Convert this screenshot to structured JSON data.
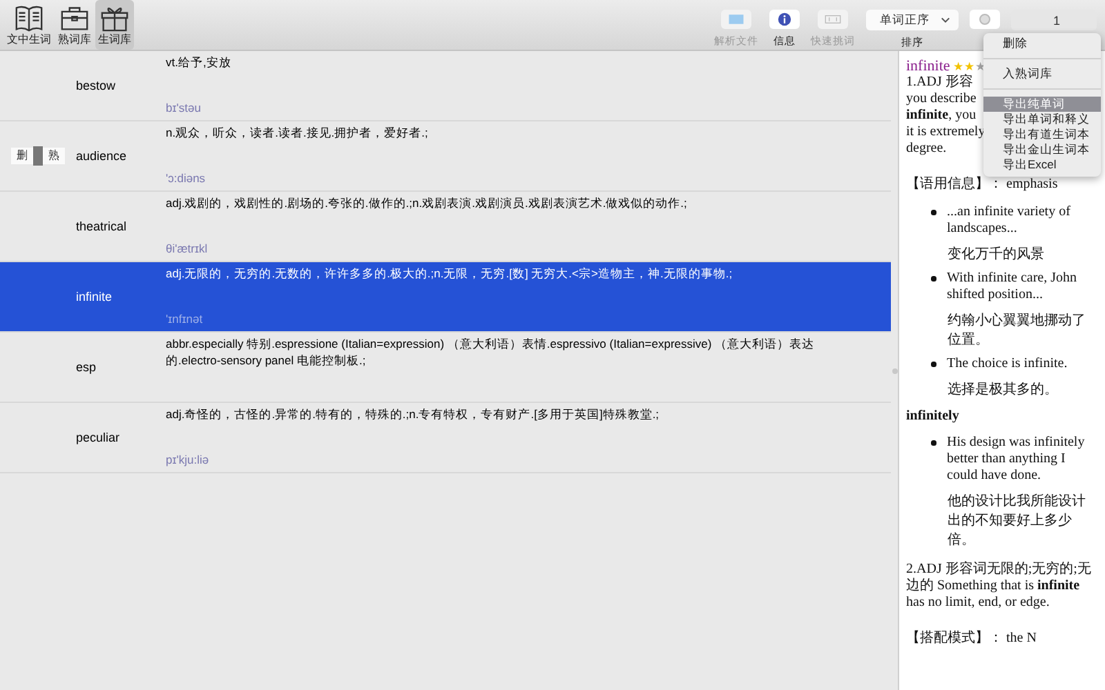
{
  "toolbar_left": [
    {
      "label": "文中生词",
      "selected": false
    },
    {
      "label": "熟词库",
      "selected": false
    },
    {
      "label": "生词库",
      "selected": true
    }
  ],
  "toolbar_right": [
    {
      "kind": "button",
      "label": "解析文件",
      "disabled": true
    },
    {
      "kind": "button",
      "label": "信息",
      "disabled": false
    },
    {
      "kind": "button",
      "label": "快速挑词",
      "disabled": true
    },
    {
      "kind": "dropdown",
      "label": "排序",
      "value": "单词正序"
    },
    {
      "kind": "button",
      "disabled": false
    }
  ],
  "page_dropdown": {
    "value": "1"
  },
  "words": [
    {
      "word": "bestow",
      "definition": "vt.给予,安放",
      "phonetic": "bɪ'stəu",
      "selected": false
    },
    {
      "word": "audience",
      "definition": "n.观众，听众，读者.读者.接见.拥护者，爱好者.;",
      "phonetic": "'ɔ:diəns",
      "selected": false,
      "actions": [
        "删",
        "熟"
      ]
    },
    {
      "word": "theatrical",
      "definition": "adj.戏剧的，戏剧性的.剧场的.夸张的.做作的.;n.戏剧表演.戏剧演员.戏剧表演艺术.做戏似的动作.;",
      "phonetic": "θi'ætrɪkl",
      "selected": false
    },
    {
      "word": "infinite",
      "definition": "adj.无限的，无穷的.无数的，许许多多的.极大的.;n.无限，无穷.[数] 无穷大.<宗>造物主，神.无限的事物.;",
      "phonetic": "'ɪnfɪnət",
      "selected": true
    },
    {
      "word": "esp",
      "definition": "abbr.especially 特别.espressione (Italian=expression) （意大利语）表情.espressivo (Italian=expressive) （意大利语）表达的.electro-sensory panel 电能控制板.;",
      "selected": false
    },
    {
      "word": "peculiar",
      "definition": "adj.奇怪的，古怪的.异常的.特有的，特殊的.;n.专有特权，专有财产.[多用于英国]特殊教堂.;",
      "phonetic": "pɪ'kju:liə",
      "selected": false
    }
  ],
  "menu": {
    "groups": [
      [
        {
          "label": "删除",
          "selected": false
        }
      ],
      [
        {
          "label": "入熟词库",
          "selected": false
        }
      ],
      [
        {
          "label": "导出纯单词",
          "selected": true
        },
        {
          "label": "导出单词和释义",
          "selected": false
        },
        {
          "label": "导出有道生词本",
          "selected": false
        },
        {
          "label": "导出金山生词本",
          "selected": false
        },
        {
          "label": "导出Excel",
          "selected": false
        }
      ]
    ]
  },
  "detail": {
    "headword": "infinite",
    "stars": 2,
    "blocks": [
      {
        "kind": "lines",
        "lines": [
          "1.ADJ 形容",
          "you describe",
          "**infinite**, you",
          "it is extremely",
          "degree."
        ]
      },
      {
        "kind": "info",
        "text": "【语用信息】： emphasis"
      },
      {
        "kind": "example",
        "en": "...an infinite variety of landscapes...",
        "zh": "变化万千的风景"
      },
      {
        "kind": "example",
        "en": "With infinite care, John shifted position...",
        "zh": "约翰小心翼翼地挪动了位置。"
      },
      {
        "kind": "example",
        "en": "The choice is infinite.",
        "zh": "选择是极其多的。"
      },
      {
        "kind": "subhead",
        "text": "infinitely"
      },
      {
        "kind": "example",
        "en": "His design was infinitely better than anything I could have done.",
        "zh": "他的设计比我所能设计出的不知要好上多少倍。"
      },
      {
        "kind": "para",
        "text": "2.ADJ 形容词无限的;无穷的;无边的 Something that is **infinite** has no limit, end, or edge."
      },
      {
        "kind": "info",
        "text": "【搭配模式】： the N"
      }
    ]
  }
}
